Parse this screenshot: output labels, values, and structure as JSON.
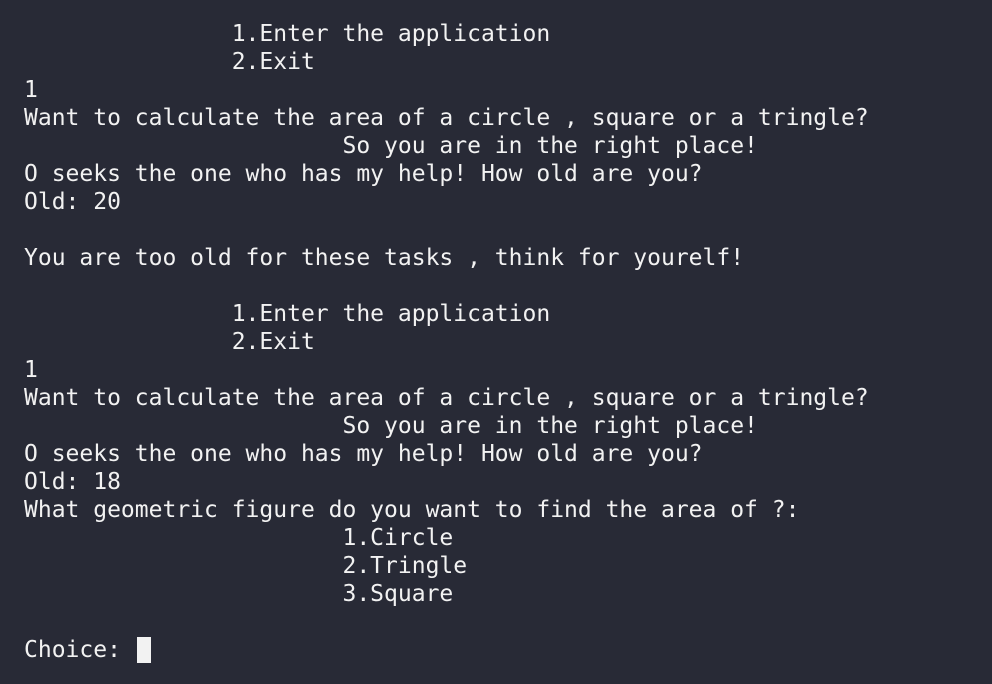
{
  "terminal": {
    "lines": [
      "               1.Enter the application",
      "               2.Exit",
      "1",
      "Want to calculate the area of a circle , square or a tringle?",
      "                       So you are in the right place!",
      "O seeks the one who has my help! How old are you?",
      "Old: 20",
      "",
      "You are too old for these tasks , think for yourelf!",
      "",
      "               1.Enter the application",
      "               2.Exit",
      "1",
      "Want to calculate the area of a circle , square or a tringle?",
      "                       So you are in the right place!",
      "O seeks the one who has my help! How old are you?",
      "Old: 18",
      "What geometric figure do you want to find the area of ?:",
      "                       1.Circle",
      "                       2.Tringle",
      "                       3.Square",
      ""
    ],
    "prompt": "Choice: "
  }
}
